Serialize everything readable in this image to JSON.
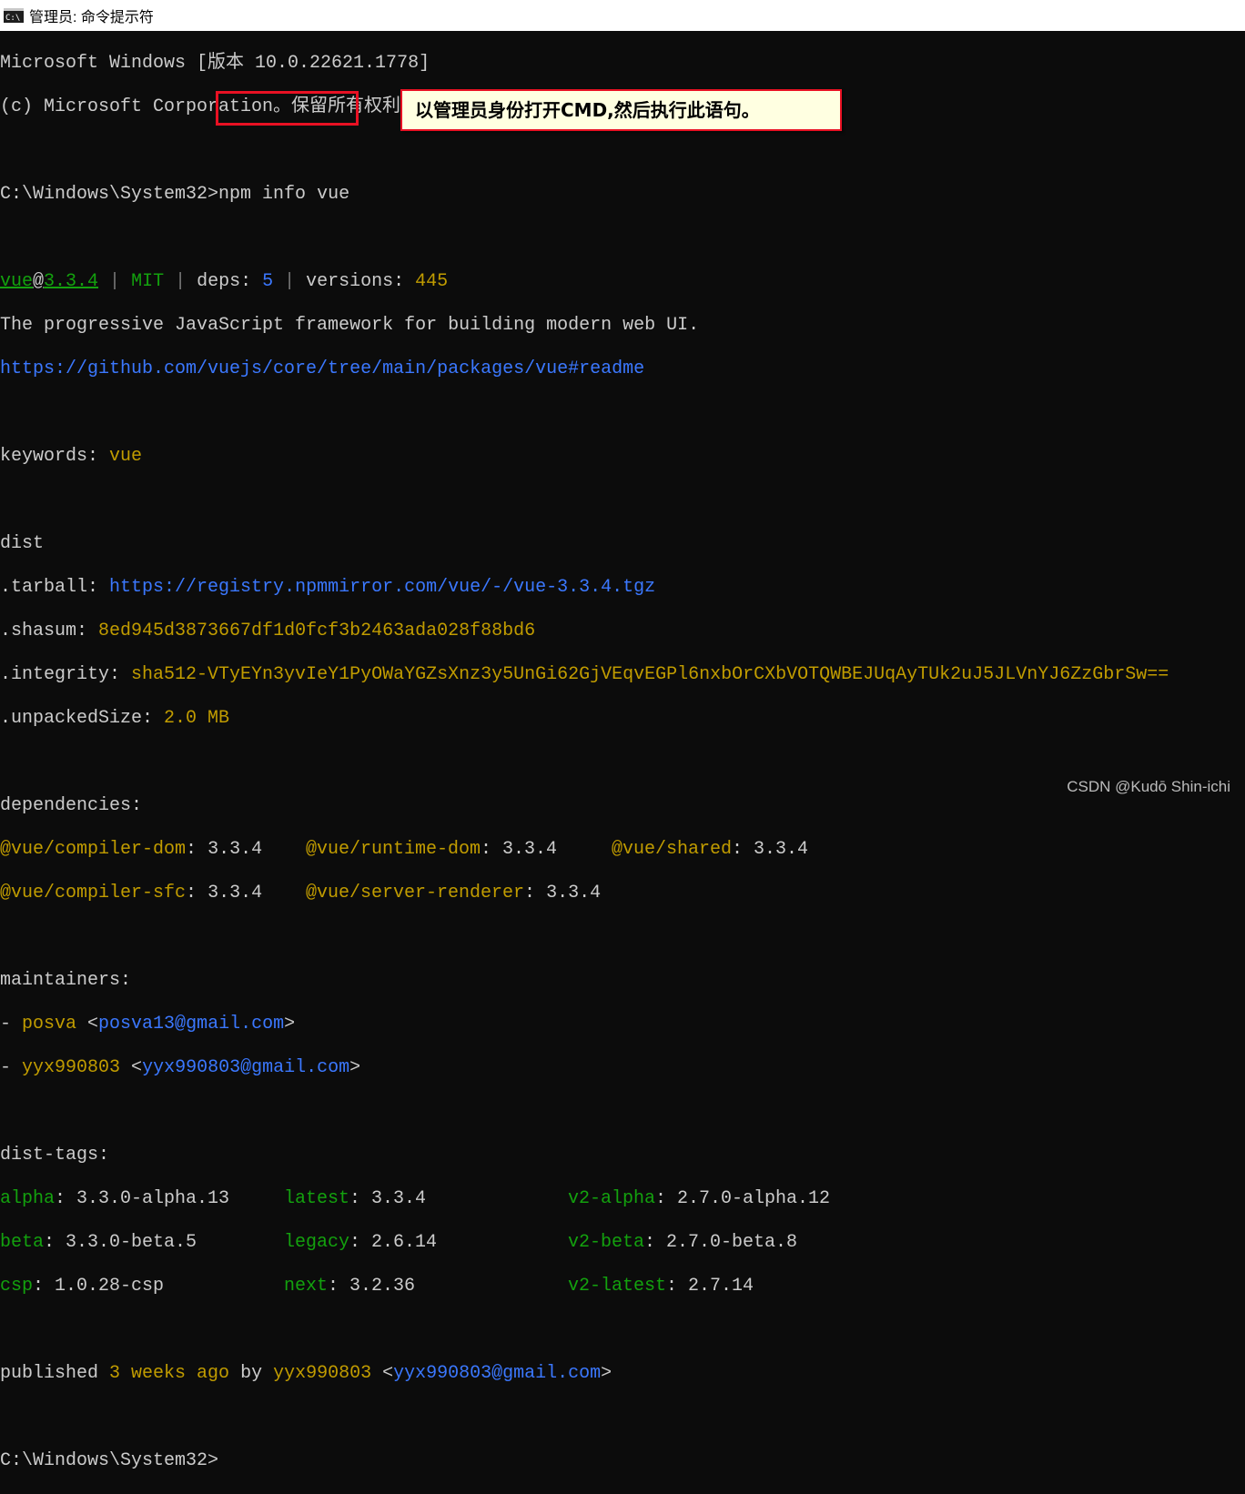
{
  "window": {
    "title": "管理员: 命令提示符",
    "icon": "cmd-icon"
  },
  "terminal": {
    "banner_1": "Microsoft Windows [版本 10.0.22621.1778]",
    "banner_2": "(c) Microsoft Corporation。保留所有权利。",
    "prompt": "C:\\Windows\\System32>",
    "command": "npm info vue",
    "pkg_name": "vue",
    "pkg_at": "@",
    "pkg_version": "3.3.4",
    "sep": " | ",
    "license": "MIT",
    "deps_label": "deps: ",
    "deps_count": "5",
    "versions_label": "versions: ",
    "versions_count": "445",
    "description": "The progressive JavaScript framework for building modern web UI.",
    "homepage": "https://github.com/vuejs/core/tree/main/packages/vue#readme",
    "keywords_label": "keywords: ",
    "keywords_value": "vue",
    "dist_label": "dist",
    "tarball_label": ".tarball: ",
    "tarball_value": "https://registry.npmmirror.com/vue/-/vue-3.3.4.tgz",
    "shasum_label": ".shasum: ",
    "shasum_value": "8ed945d3873667df1d0fcf3b2463ada028f88bd6",
    "integrity_label": ".integrity: ",
    "integrity_value": "sha512-VTyEYn3yvIeY1PyOWaYGZsXnz3y5UnGi62GjVEqvEGPl6nxbOrCXbVOTQWBEJUqAyTUk2uJ5JLVnYJ6ZzGbrSw==",
    "unpacked_label": ".unpackedSize: ",
    "unpacked_value": "2.0 MB",
    "dependencies_label": "dependencies:",
    "dependencies": [
      {
        "name": "@vue/compiler-dom",
        "version": "3.3.4"
      },
      {
        "name": "@vue/runtime-dom",
        "version": "3.3.4"
      },
      {
        "name": "@vue/shared",
        "version": "3.3.4"
      },
      {
        "name": "@vue/compiler-sfc",
        "version": "3.3.4"
      },
      {
        "name": "@vue/server-renderer",
        "version": "3.3.4"
      }
    ],
    "maintainers_label": "maintainers:",
    "maintainers": [
      {
        "name": "posva",
        "email": "posva13@gmail.com"
      },
      {
        "name": "yyx990803",
        "email": "yyx990803@gmail.com"
      }
    ],
    "dist_tags_label": "dist-tags:",
    "dist_tags": [
      {
        "tag": "alpha",
        "value": "3.3.0-alpha.13"
      },
      {
        "tag": "latest",
        "value": "3.3.4"
      },
      {
        "tag": "v2-alpha",
        "value": "2.7.0-alpha.12"
      },
      {
        "tag": "beta",
        "value": "3.3.0-beta.5"
      },
      {
        "tag": "legacy",
        "value": "2.6.14"
      },
      {
        "tag": "v2-beta",
        "value": "2.7.0-beta.8"
      },
      {
        "tag": "csp",
        "value": "1.0.28-csp"
      },
      {
        "tag": "next",
        "value": "3.2.36"
      },
      {
        "tag": "v2-latest",
        "value": "2.7.14"
      }
    ],
    "published_label": "published ",
    "published_when": "3 weeks ago",
    "published_by": " by ",
    "publisher": "yyx990803",
    "publisher_email": "yyx990803@gmail.com",
    "final_prompt": "C:\\Windows\\System32>"
  },
  "annotation": {
    "callout_text": "以管理员身份打开CMD,然后执行此语句。"
  },
  "watermark": "CSDN @Kudō Shin-ichi",
  "colors": {
    "background": "#0c0c0c",
    "text": "#cccccc",
    "green": "#13a10e",
    "yellow": "#c19c00",
    "blue": "#3b78ff",
    "highlight_border": "#e81123",
    "callout_bg": "#ffffe1"
  }
}
